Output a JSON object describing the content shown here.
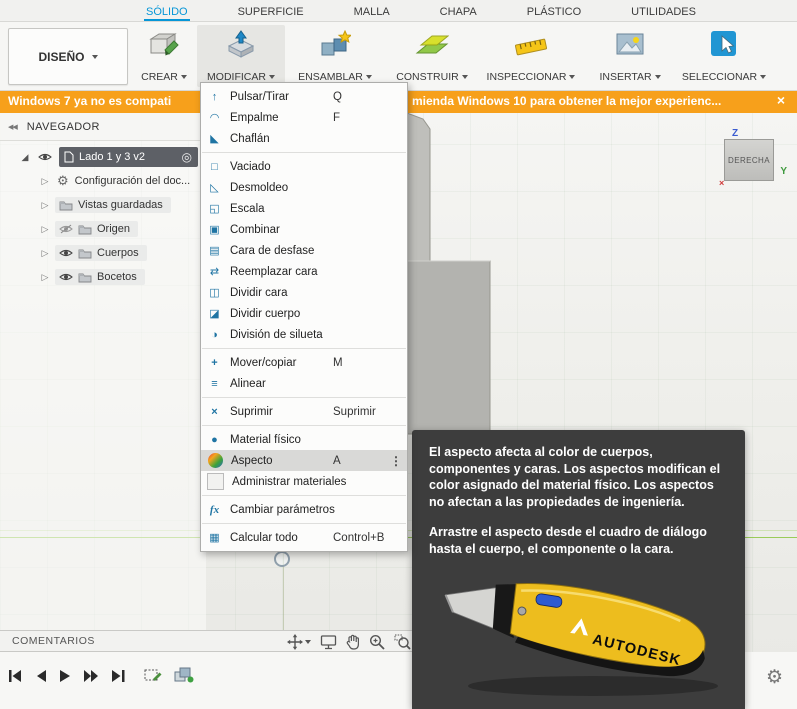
{
  "colors": {
    "accent_blue": "#0696d7",
    "banner_orange": "#f7a01b",
    "selection_dark": "#5d6066",
    "tooltip_bg": "#3d3d3d"
  },
  "ribbon_tabs": [
    "SÓLIDO",
    "SUPERFICIE",
    "MALLA",
    "CHAPA",
    "PLÁSTICO",
    "UTILIDADES"
  ],
  "toolbar": {
    "design_button": "DISEÑO",
    "groups": [
      "CREAR",
      "MODIFICAR",
      "ENSAMBLAR",
      "CONSTRUIR",
      "INSPECCIONAR",
      "INSERTAR",
      "SELECCIONAR"
    ]
  },
  "banner": {
    "message_left": "Windows 7 ya no es compati",
    "message_right": "mienda Windows 10 para obtener la mejor experienc..."
  },
  "navigator": {
    "title": "NAVEGADOR",
    "root_label": "Lado 1 y 3 v2",
    "rows": [
      "Configuración del doc...",
      "Vistas guardadas",
      "Origen",
      "Cuerpos",
      "Bocetos"
    ]
  },
  "modify_menu": {
    "items": [
      {
        "label": "Pulsar/Tirar",
        "shortcut": "Q"
      },
      {
        "label": "Empalme",
        "shortcut": "F"
      },
      {
        "label": "Chaflán",
        "shortcut": ""
      },
      {
        "label": "Vaciado",
        "shortcut": ""
      },
      {
        "label": "Desmoldeo",
        "shortcut": ""
      },
      {
        "label": "Escala",
        "shortcut": ""
      },
      {
        "label": "Combinar",
        "shortcut": ""
      },
      {
        "label": "Cara de desfase",
        "shortcut": ""
      },
      {
        "label": "Reemplazar cara",
        "shortcut": ""
      },
      {
        "label": "Dividir cara",
        "shortcut": ""
      },
      {
        "label": "Dividir cuerpo",
        "shortcut": ""
      },
      {
        "label": "División de silueta",
        "shortcut": ""
      },
      {
        "label": "Mover/copiar",
        "shortcut": "M"
      },
      {
        "label": "Alinear",
        "shortcut": ""
      },
      {
        "label": "Suprimir",
        "shortcut": "Suprimir"
      },
      {
        "label": "Material físico",
        "shortcut": ""
      },
      {
        "label": "Aspecto",
        "shortcut": "A"
      },
      {
        "label": "Administrar materiales",
        "shortcut": ""
      },
      {
        "label": "Cambiar parámetros",
        "shortcut": ""
      },
      {
        "label": "Calcular todo",
        "shortcut": "Control+B"
      }
    ]
  },
  "tooltip": {
    "paragraph1": "El aspecto afecta al color de cuerpos, componentes y caras. Los aspectos modifican el color asignado del material físico. Los aspectos no afectan a las propiedades de ingeniería.",
    "paragraph2": "Arrastre el aspecto desde el cuadro de diálogo hasta el cuerpo, el componente o la cara.",
    "knife_brand": "AUTODESK"
  },
  "viewcube": {
    "face": "DERECHA",
    "axis_z": "Z",
    "axis_y": "Y",
    "axis_x_marker": "×"
  },
  "comments": {
    "label": "COMENTARIOS"
  },
  "icons": {
    "push_pull": "↑",
    "fillet": "◠",
    "chamfer": "◣",
    "shell": "□",
    "draft": "◺",
    "scale": "◱",
    "combine": "▣",
    "offset_face": "▤",
    "replace_face": "⇄",
    "split_face": "◫",
    "split_body": "◪",
    "silhouette": "◑",
    "move": "+",
    "align": "≡",
    "delete": "×",
    "material": "●",
    "params": "fx",
    "compute": "▦",
    "ellipsis": "⋮",
    "target": "◎",
    "gear": "⚙",
    "close": "×",
    "collapse": "◀◀",
    "expand_closed": "▷",
    "expand_open": "◢"
  }
}
